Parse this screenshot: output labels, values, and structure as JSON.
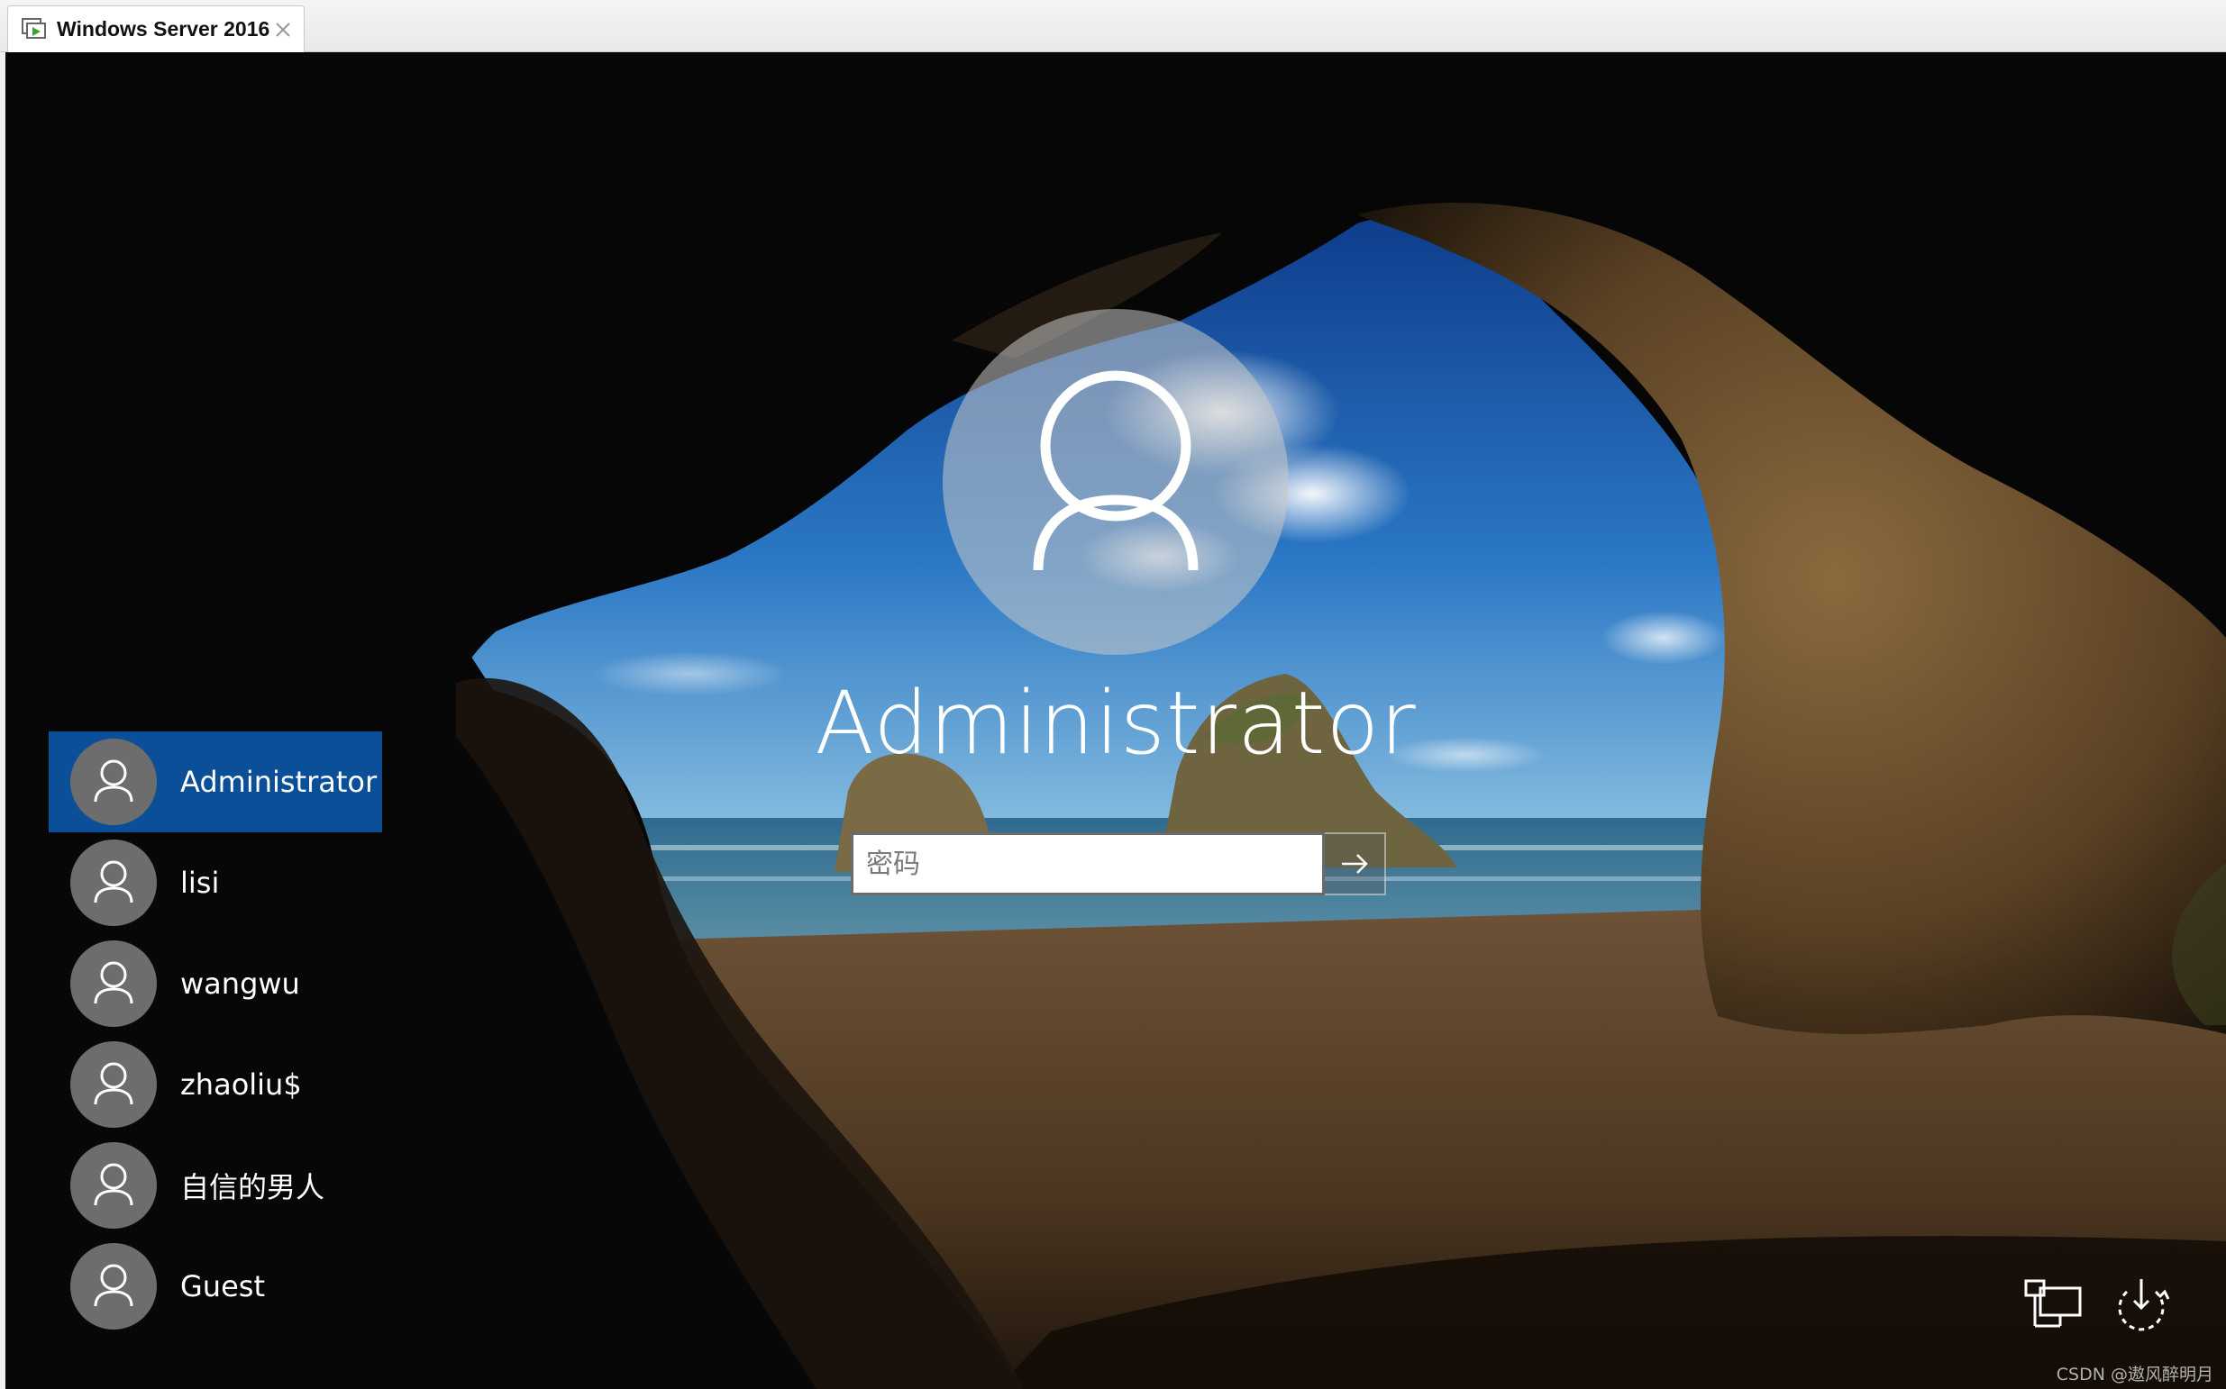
{
  "host": {
    "tab_title": "Windows Server 2016",
    "tab_icon": "vm-play-icon",
    "close_icon": "close-icon"
  },
  "login": {
    "selected_user": "Administrator",
    "password_placeholder": "密码",
    "password_value": "",
    "submit_icon": "arrow-right-icon"
  },
  "users": [
    {
      "label": "Administrator",
      "selected": true
    },
    {
      "label": "lisi",
      "selected": false
    },
    {
      "label": "wangwu",
      "selected": false
    },
    {
      "label": "zhaoliu$",
      "selected": false
    },
    {
      "label": "自信的男人",
      "selected": false
    },
    {
      "label": "Guest",
      "selected": false
    }
  ],
  "corner_icons": [
    "network-icon",
    "power-icon"
  ],
  "watermark": "CSDN @遨风醉明月",
  "colors": {
    "selected_user_bg": "#0a4f97",
    "avatar_bg": "#6d6d6d"
  }
}
